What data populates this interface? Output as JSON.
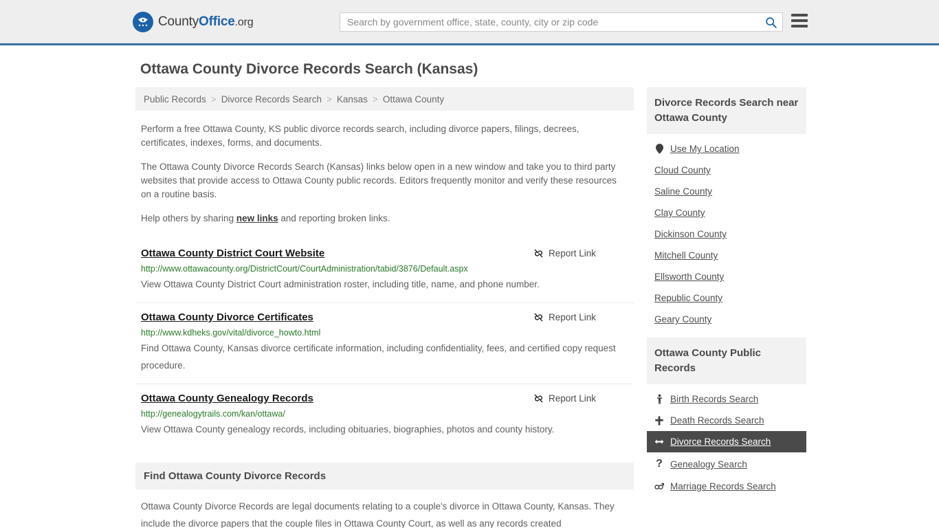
{
  "header": {
    "logo": {
      "part1": "County",
      "part2": "Office",
      "part3": ".org",
      "icon": "eagle-seal-icon"
    },
    "search": {
      "placeholder": "Search by government office, state, county, city or zip code",
      "value": "",
      "icon": "search-icon"
    },
    "menu_icon": "hamburger-menu-icon"
  },
  "page": {
    "title": "Ottawa County Divorce Records Search (Kansas)"
  },
  "breadcrumb": {
    "separator": ">",
    "items": [
      "Public Records",
      "Divorce Records Search",
      "Kansas",
      "Ottawa County"
    ]
  },
  "intro": {
    "p1": "Perform a free Ottawa County, KS public divorce records search, including divorce papers, filings, decrees, certificates, indexes, forms, and documents.",
    "p2": "The Ottawa County Divorce Records Search (Kansas) links below open in a new window and take you to third party websites that provide access to Ottawa County public records. Editors frequently monitor and verify these resources on a routine basis.",
    "p3_before": "Help others by sharing ",
    "p3_link": "new links",
    "p3_after": " and reporting broken links."
  },
  "results": {
    "report_label": "Report Link",
    "report_icon": "broken-link-icon",
    "items": [
      {
        "title": "Ottawa County District Court Website",
        "url": "http://www.ottawacounty.org/DistrictCourt/CourtAdministration/tabid/3876/Default.aspx",
        "description": "View Ottawa County District Court administration roster, including title, name, and phone number."
      },
      {
        "title": "Ottawa County Divorce Certificates",
        "url": "http://www.kdheks.gov/vital/divorce_howto.html",
        "description": "Find Ottawa County, Kansas divorce certificate information, including confidentiality, fees, and certified copy request procedure."
      },
      {
        "title": "Ottawa County Genealogy Records",
        "url": "http://genealogytrails.com/kan/ottawa/",
        "description": "View Ottawa County genealogy records, including obituaries, biographies, photos and county history."
      }
    ]
  },
  "find_section": {
    "title": "Find Ottawa County Divorce Records",
    "body": "Ottawa County Divorce Records are legal documents relating to a couple's divorce in Ottawa County, Kansas. They include the divorce papers that the couple files in Ottawa County Court, as well as any records created"
  },
  "sidebar": {
    "nearby": {
      "title": "Divorce Records Search near Ottawa County",
      "use_my_location": {
        "label": "Use My Location",
        "icon": "location-pin-icon"
      },
      "counties": [
        "Cloud County",
        "Saline County",
        "Clay County",
        "Dickinson County",
        "Mitchell County",
        "Ellsworth County",
        "Republic County",
        "Geary County"
      ]
    },
    "public_records": {
      "title": "Ottawa County Public Records",
      "items": [
        {
          "label": "Birth Records Search",
          "icon": "baby-icon",
          "glyph": "Ɣ",
          "active": false
        },
        {
          "label": "Death Records Search",
          "icon": "cross-icon",
          "glyph": "†",
          "active": false
        },
        {
          "label": "Divorce Records Search",
          "icon": "left-right-arrow-icon",
          "glyph": "↔",
          "active": true
        },
        {
          "label": "Genealogy Search",
          "icon": "question-mark-icon",
          "glyph": "?",
          "active": false
        },
        {
          "label": "Marriage Records Search",
          "icon": "male-female-icon",
          "glyph": "⚥",
          "active": false
        }
      ]
    }
  },
  "colors": {
    "brand_blue": "#1d62a8",
    "header_border": "#37729f",
    "url_green": "#2a7a2a",
    "active_bg": "#4a4a4a",
    "panel_gray": "#f2f2f2"
  }
}
